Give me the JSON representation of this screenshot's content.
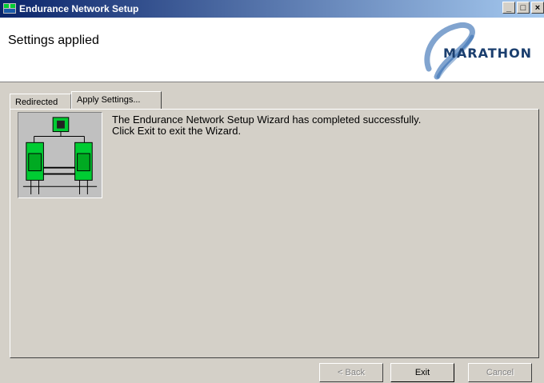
{
  "window": {
    "title": "Endurance Network Setup"
  },
  "header": {
    "heading": "Settings applied",
    "logo_text": "MARATHON"
  },
  "tabs": [
    {
      "label": "Redirected"
    },
    {
      "label": "Apply Settings..."
    }
  ],
  "message": {
    "line1": "The Endurance Network Setup Wizard has completed successfully.",
    "line2": "Click Exit to exit the Wizard."
  },
  "buttons": {
    "back": "< Back",
    "exit": "Exit",
    "cancel": "Cancel"
  },
  "colors": {
    "titlebar": "#0a246a",
    "diagram_green": "#00cc33",
    "logo_blue": "#1a5aa8"
  }
}
